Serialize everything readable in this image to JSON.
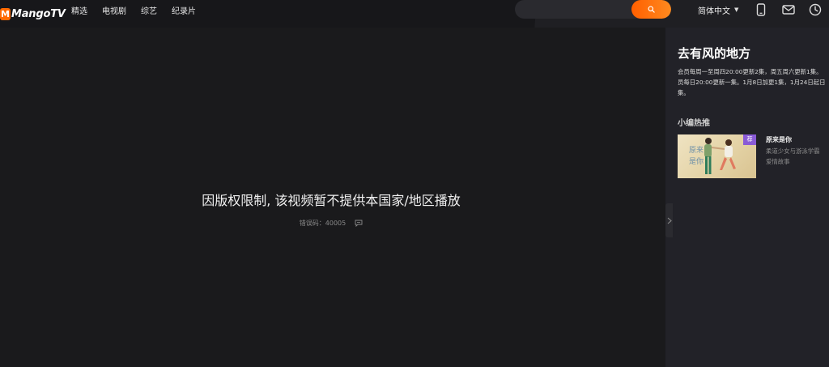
{
  "brand": {
    "logo_mark": "M",
    "logo_text": "MangoTV",
    "accent_color": "#ff6a00"
  },
  "nav": {
    "items": [
      "精选",
      "电视剧",
      "综艺",
      "纪录片"
    ]
  },
  "search": {
    "placeholder": "",
    "icon": "search-icon"
  },
  "header": {
    "language": "简体中文",
    "icons": [
      "mobile-icon",
      "mail-icon",
      "clock-icon"
    ]
  },
  "player": {
    "message": "因版权限制, 该视频暂不提供本国家/地区播放",
    "error_code": "错误码：40005",
    "feedback_icon": "feedback-icon"
  },
  "side": {
    "title": "去有风的地方",
    "desc_lines": [
      "会员每周一至周四20:00更新2集，周五周六更新1集。",
      "员每日20:00更新一集。1月8日加更1集，1月24日起日",
      "集。"
    ],
    "rec_heading": "小编热推",
    "rec": {
      "badge": "荐",
      "title": "原来是你",
      "desc_lines": [
        "柔道少女与游泳学霸",
        "爱情故事"
      ],
      "thumb_caption": "原来是你"
    }
  }
}
